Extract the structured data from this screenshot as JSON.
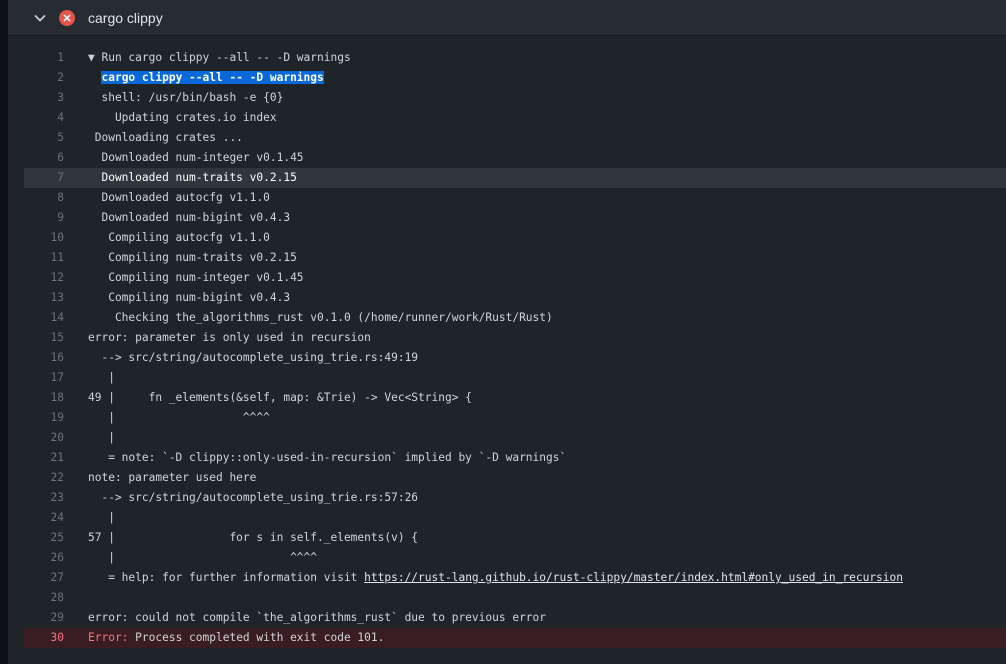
{
  "step": {
    "title": "cargo clippy",
    "status": "failed",
    "icons": {
      "toggle": "chevron-down-icon",
      "status": "error-circle-icon"
    },
    "colors": {
      "error": "#e5534b",
      "selection": "#0969da"
    }
  },
  "log_lines": [
    {
      "n": "1",
      "pre": "",
      "caret": "▼ ",
      "text": "Run cargo clippy --all -- -D warnings"
    },
    {
      "n": "2",
      "pre": "  ",
      "sel": "cargo clippy --all -- -D warnings"
    },
    {
      "n": "3",
      "pre": "  ",
      "text": "shell: /usr/bin/bash -e {0}"
    },
    {
      "n": "4",
      "text": "    Updating crates.io index"
    },
    {
      "n": "5",
      "text": " Downloading crates ..."
    },
    {
      "n": "6",
      "text": "  Downloaded num-integer v0.1.45"
    },
    {
      "n": "7",
      "text": "  Downloaded num-traits v0.2.15",
      "hover": true
    },
    {
      "n": "8",
      "text": "  Downloaded autocfg v1.1.0"
    },
    {
      "n": "9",
      "text": "  Downloaded num-bigint v0.4.3"
    },
    {
      "n": "10",
      "text": "   Compiling autocfg v1.1.0"
    },
    {
      "n": "11",
      "text": "   Compiling num-traits v0.2.15"
    },
    {
      "n": "12",
      "text": "   Compiling num-integer v0.1.45"
    },
    {
      "n": "13",
      "text": "   Compiling num-bigint v0.4.3"
    },
    {
      "n": "14",
      "text": "    Checking the_algorithms_rust v0.1.0 (/home/runner/work/Rust/Rust)"
    },
    {
      "n": "15",
      "text": "error: parameter is only used in recursion"
    },
    {
      "n": "16",
      "text": "  --> src/string/autocomplete_using_trie.rs:49:19"
    },
    {
      "n": "17",
      "text": "   |"
    },
    {
      "n": "18",
      "text": "49 |     fn _elements(&self, map: &Trie) -> Vec<String> {"
    },
    {
      "n": "19",
      "text": "   |                   ^^^^"
    },
    {
      "n": "20",
      "text": "   |"
    },
    {
      "n": "21",
      "text": "   = note: `-D clippy::only-used-in-recursion` implied by `-D warnings`"
    },
    {
      "n": "22",
      "text": "note: parameter used here"
    },
    {
      "n": "23",
      "text": "  --> src/string/autocomplete_using_trie.rs:57:26"
    },
    {
      "n": "24",
      "text": "   |"
    },
    {
      "n": "25",
      "text": "57 |                 for s in self._elements(v) {"
    },
    {
      "n": "26",
      "text": "   |                          ^^^^"
    },
    {
      "n": "27",
      "text": "   = help: for further information visit ",
      "link": "https://rust-lang.github.io/rust-clippy/master/index.html#only_used_in_recursion"
    },
    {
      "n": "28",
      "text": ""
    },
    {
      "n": "29",
      "text": "error: could not compile `the_algorithms_rust` due to previous error"
    },
    {
      "n": "30",
      "errkw": "Error:",
      "text": " Process completed with exit code 101.",
      "error_row": true
    }
  ]
}
